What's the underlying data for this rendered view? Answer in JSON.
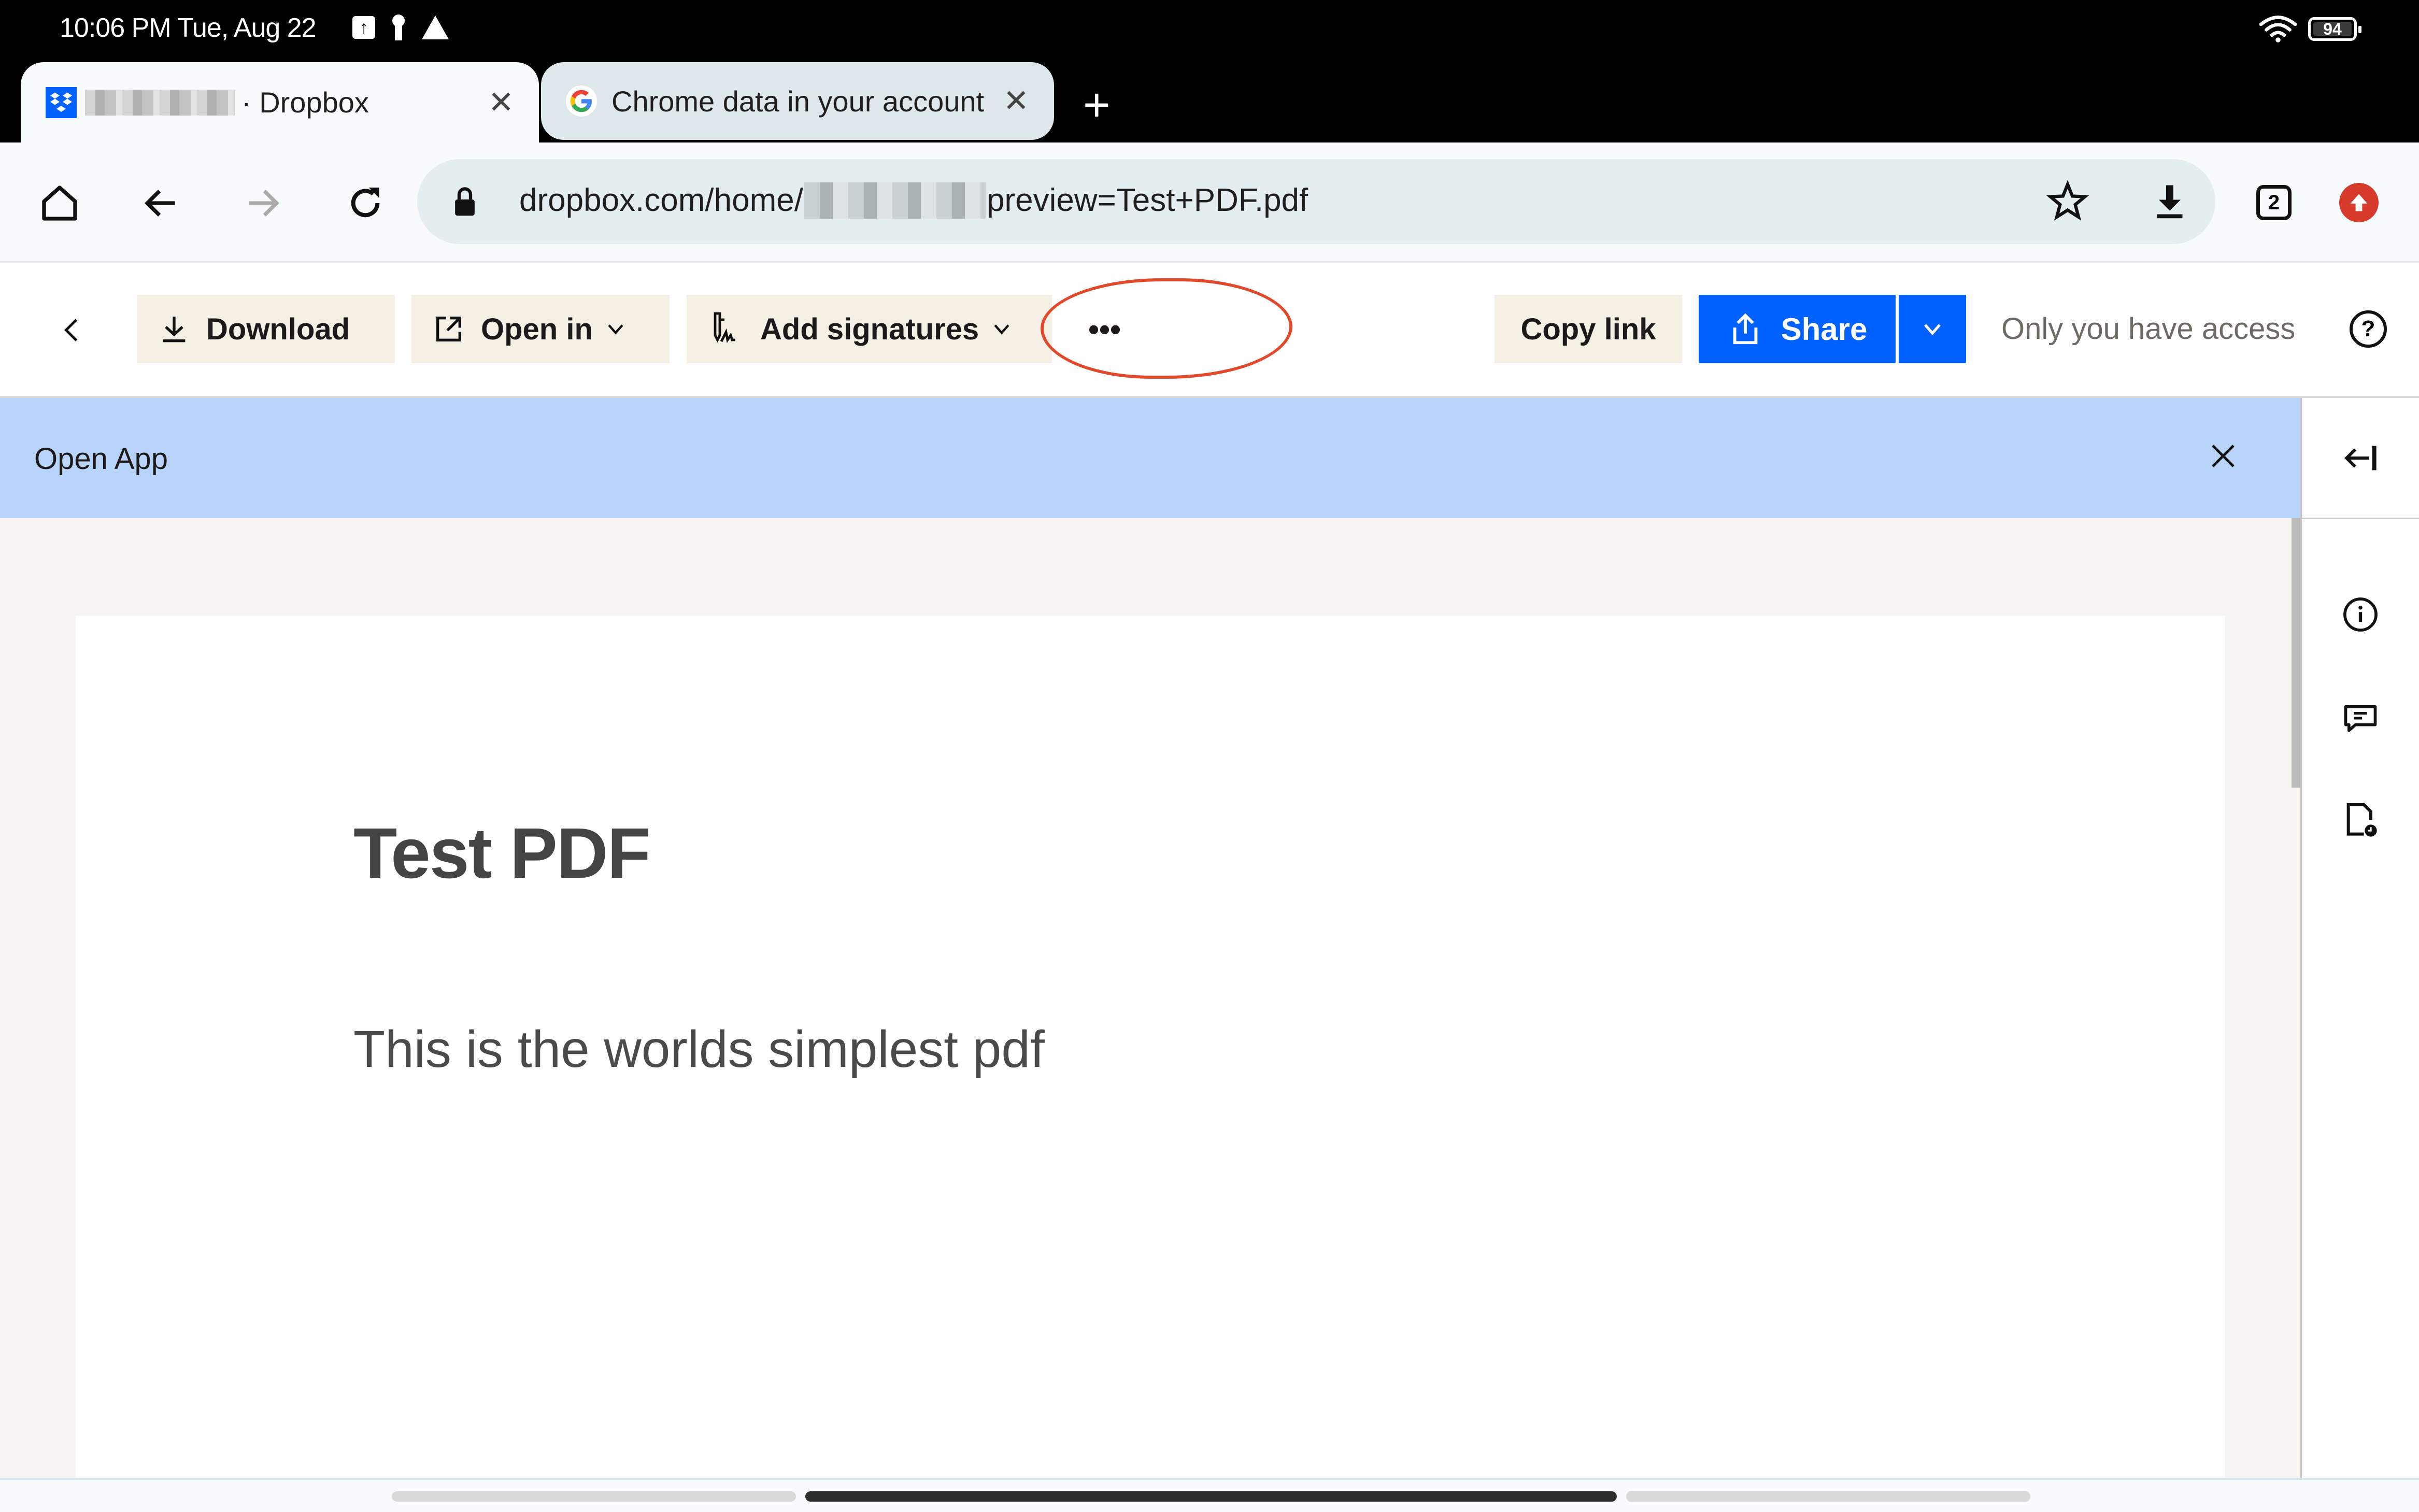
{
  "status_bar": {
    "time": "10:06 PM Tue, Aug 22",
    "icons": [
      "upload-icon",
      "keyhole-icon",
      "warning-icon"
    ],
    "wifi": "wifi-icon",
    "battery": "94"
  },
  "tabs": [
    {
      "title": "· Dropbox",
      "favicon": "dropbox-icon",
      "active": true,
      "title_redacted": true
    },
    {
      "title": "Chrome data in your account",
      "favicon": "google-icon",
      "active": false
    }
  ],
  "toolbar": {
    "url_prefix": "dropbox.com/home/",
    "url_suffix": "preview=Test+PDF.pdf",
    "tab_count": "2"
  },
  "actionbar": {
    "download_label": "Download",
    "open_in_label": "Open in",
    "add_signatures_label": "Add signatures",
    "more_label": "•••",
    "copy_link_label": "Copy link",
    "share_label": "Share",
    "access_label": "Only you have access",
    "help_label": "?"
  },
  "banner": {
    "label": "Open App"
  },
  "document": {
    "title": "Test PDF",
    "body": "This is the worlds simplest pdf"
  },
  "colors": {
    "share_blue": "#0061fe",
    "banner_blue": "#b8d4fa",
    "button_beige": "#f5efe6",
    "annotation_red": "#e04a2a",
    "update_red": "#d53a2b"
  }
}
